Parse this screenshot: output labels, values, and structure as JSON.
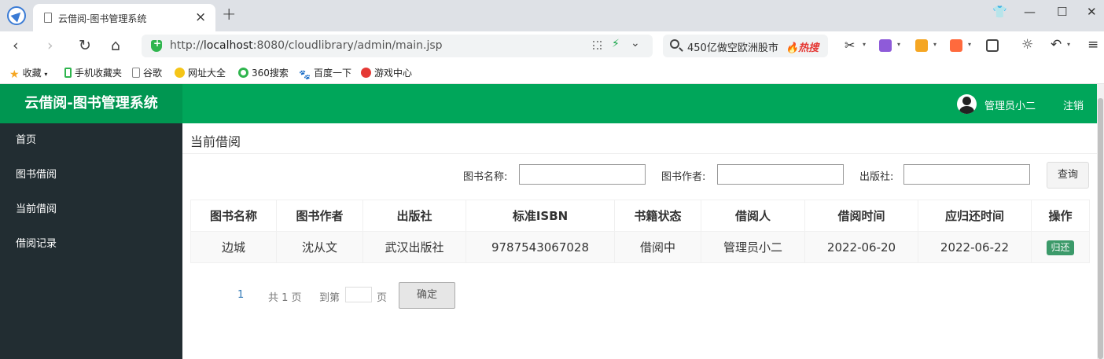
{
  "browser": {
    "tab_title": "云借阅-图书管理系统",
    "tab_close": "×",
    "new_tab": "+",
    "url_host": "localhost",
    "url_prefix": "http://",
    "url_rest": ":8080/cloudlibrary/admin/main.jsp",
    "search_text": "450亿做空欧洲股市",
    "search_hot": "🔥热搜",
    "minimize": "—",
    "maximize": "☐",
    "close": "✕",
    "bookmarks": [
      "收藏",
      "手机收藏夹",
      "谷歌",
      "网址大全",
      "360搜索",
      "百度一下",
      "游戏中心"
    ]
  },
  "header": {
    "logo": "云借阅-图书管理系统",
    "user": "管理员小二",
    "logout": "注销"
  },
  "sidebar": {
    "items": [
      {
        "label": "首页"
      },
      {
        "label": "图书借阅"
      },
      {
        "label": "当前借阅"
      },
      {
        "label": "借阅记录"
      }
    ]
  },
  "main": {
    "title": "当前借阅",
    "filters": {
      "book_name_label": "图书名称:",
      "author_label": "图书作者:",
      "publisher_label": "出版社:",
      "book_name_value": "",
      "author_value": "",
      "publisher_value": "",
      "query_button": "查询"
    },
    "table": {
      "headers": [
        "图书名称",
        "图书作者",
        "出版社",
        "标准ISBN",
        "书籍状态",
        "借阅人",
        "借阅时间",
        "应归还时间",
        "操作"
      ],
      "rows": [
        {
          "name": "边城",
          "author": "沈从文",
          "publisher": "武汉出版社",
          "isbn": "9787543067028",
          "status": "借阅中",
          "borrower": "管理员小二",
          "borrow_time": "2022-06-20",
          "return_time": "2022-06-22",
          "action": "归还"
        }
      ]
    },
    "pagination": {
      "current": "1",
      "total": "共 1 页",
      "goto_prefix": "到第",
      "goto_suffix": "页",
      "goto_value": "",
      "confirm": "确定"
    }
  },
  "colors": {
    "header_green": "#00a65a",
    "logo_green": "#009651",
    "sidebar_dark": "#222d32",
    "return_button": "#3c9a6a"
  }
}
